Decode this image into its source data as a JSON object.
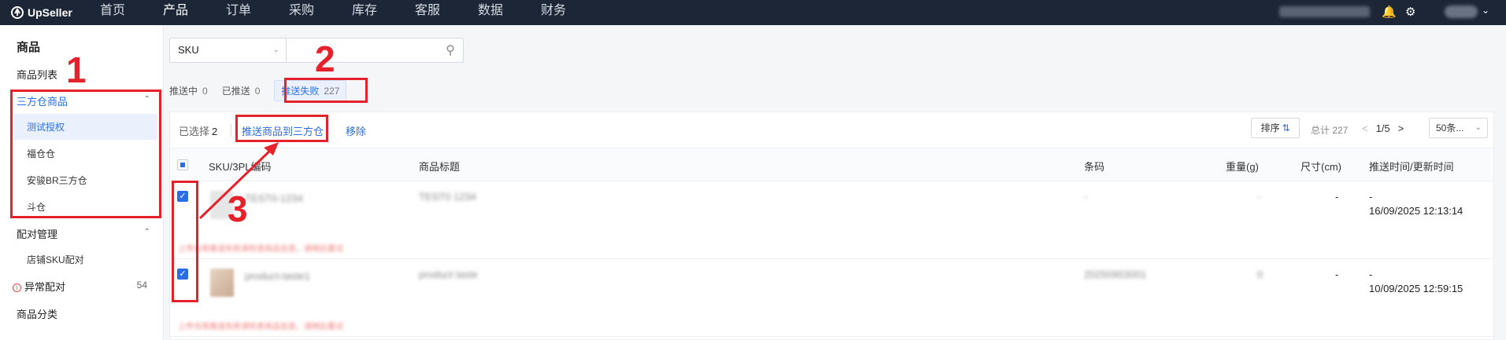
{
  "app": {
    "brand": "UpSeller"
  },
  "nav": [
    "首页",
    "产品",
    "订单",
    "采购",
    "库存",
    "客服",
    "数据",
    "财务"
  ],
  "nav_active": "产品",
  "sidebar": {
    "title": "商品",
    "product_list": "商品列表",
    "third_party": "三方仓商品",
    "third_party_children": [
      "测试授权",
      "福仓仓",
      "安骏BR三方仓",
      "斗仓"
    ],
    "pairing": "配对管理",
    "pairing_children": [
      "店铺SKU配对"
    ],
    "abnormal": "异常配对",
    "abnormal_count": "54",
    "category": "商品分类"
  },
  "search": {
    "field": "SKU"
  },
  "tabs": [
    {
      "label": "推送中",
      "count": "0"
    },
    {
      "label": "已推送",
      "count": "0"
    },
    {
      "label": "推送失败",
      "count": "227"
    }
  ],
  "toolbar": {
    "selected_label": "已选择",
    "selected_count": "2",
    "push_action": "推送商品到三方仓",
    "remove_action": "移除",
    "sort": "排序",
    "total": "总计 227",
    "page": "1/5",
    "page_size": "50条..."
  },
  "table": {
    "headers": [
      "SKU/3PL编码",
      "商品标题",
      "条码",
      "重量(g)",
      "尺寸(cm)",
      "推送时间/更新时间"
    ],
    "rows": [
      {
        "sku": "TEST0-1234",
        "title": "TEST0 1234",
        "barcode": "-",
        "weight": "-",
        "size": "-",
        "push_time": "-",
        "update_time": "16/09/2025 12:13:14"
      },
      {
        "sku": "product-taste1",
        "title": "product taste",
        "barcode": "20250903001",
        "weight": "0",
        "size": "-",
        "push_time": "-",
        "update_time": "10/09/2025 12:59:15"
      }
    ]
  },
  "annotations": [
    "1",
    "2",
    "3"
  ],
  "colors": {
    "accent": "#2b6de8",
    "annotation": "#e5222b",
    "topbar": "#1c2636"
  }
}
